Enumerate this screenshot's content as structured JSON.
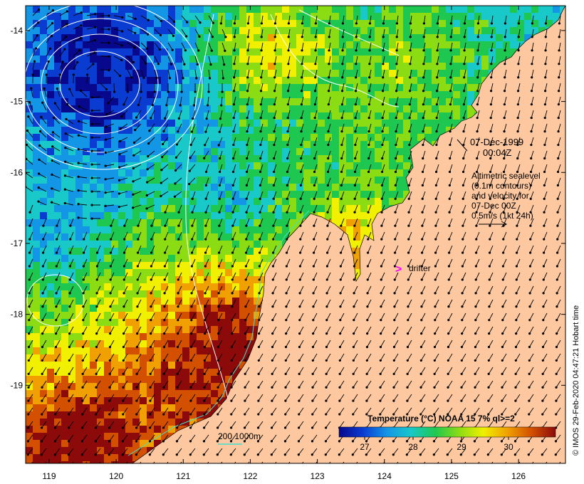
{
  "map": {
    "lon_ticks": [
      "119",
      "120",
      "121",
      "122",
      "123",
      "124",
      "125",
      "126"
    ],
    "lat_ticks": [
      "-14",
      "-15",
      "-16",
      "-17",
      "-18",
      "-19"
    ],
    "lon_range": [
      118.65,
      126.7
    ],
    "lat_range": [
      -20.1,
      -13.65
    ]
  },
  "annotations": {
    "date": "07-Dec-1999",
    "time": "00:04Z",
    "legend_lines": [
      "Altimetric sealevel",
      "(0.1m contours)",
      "and velocity for",
      "07-Dec 00Z",
      "0.5m/s (1kt 24h)"
    ],
    "drifter_label": "drifter",
    "drifter_glyph": ">",
    "scale_label": "200  1000m",
    "credit": "© IMOS 29-Feb-2020 04:47:21 Hobart time"
  },
  "colorbar": {
    "title": "Temperature (°C) NOAA 15 7% ql>=2",
    "ticks": [
      "27",
      "28",
      "29",
      "30"
    ],
    "stops": [
      "#08088c",
      "#0a3cd2",
      "#1496e6",
      "#19c8c8",
      "#1ec850",
      "#8cdc14",
      "#f0f000",
      "#f0a000",
      "#d25000",
      "#8c0a0a"
    ]
  },
  "colors": {
    "land": "#fdc8a0",
    "contour": "#ffffff",
    "isobath": "#40e0d0",
    "drifter": "#ff00ff",
    "arrow": "#000000"
  }
}
